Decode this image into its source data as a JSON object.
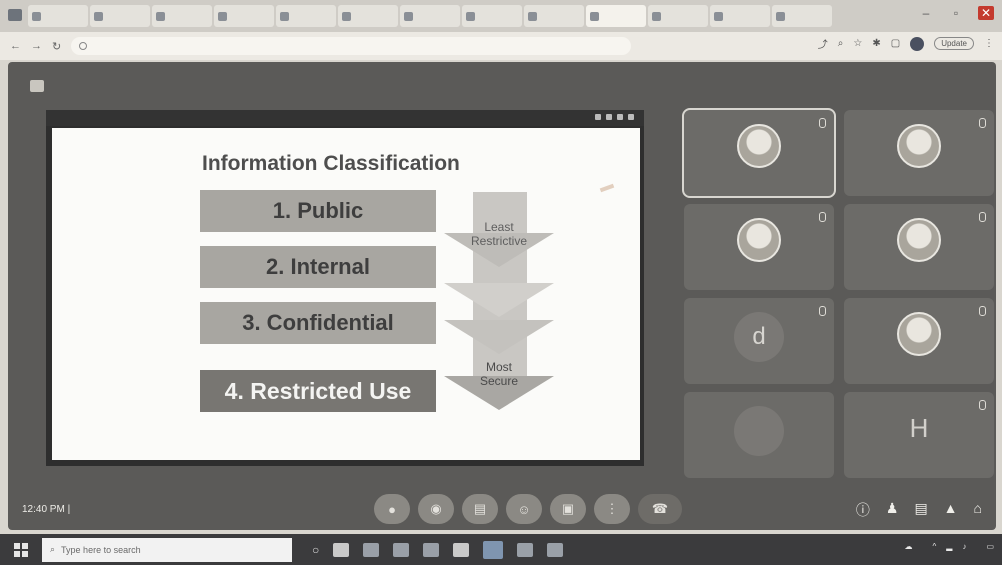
{
  "browser": {
    "tabs": [
      "",
      "",
      "",
      "",
      "",
      "",
      "",
      "",
      "",
      "",
      "",
      "",
      "",
      ""
    ],
    "active_tab": 9,
    "url": "",
    "update_label": "Update"
  },
  "meeting": {
    "title": "",
    "clock": "12:40 PM",
    "meeting_code": ""
  },
  "slide": {
    "title": "Information Classification",
    "levels": [
      "1. Public",
      "2. Internal",
      "3. Confidential",
      "4. Restricted Use"
    ],
    "arrow_top": [
      "Least",
      "Restrictive"
    ],
    "arrow_bottom": [
      "Most",
      "Secure"
    ]
  },
  "participants": [
    {
      "name": "",
      "type": "photo",
      "label": ""
    },
    {
      "name": "",
      "type": "photo",
      "label": ""
    },
    {
      "name": "",
      "type": "photo",
      "label": ""
    },
    {
      "name": "",
      "type": "photo",
      "label": ""
    },
    {
      "name": "",
      "type": "letter",
      "label": "d"
    },
    {
      "name": "",
      "type": "photo",
      "label": ""
    },
    {
      "name": "",
      "type": "letter",
      "label": ""
    },
    {
      "name": "",
      "type": "plain",
      "label": "H"
    }
  ],
  "controls": {
    "icons": [
      "mic-icon",
      "camera-icon",
      "captions-icon",
      "emoji-icon",
      "present-icon",
      "more-options-icon",
      "end-call-icon"
    ],
    "right_icons": [
      "info-icon",
      "people-icon",
      "chat-icon",
      "activities-icon",
      "host-controls-icon"
    ]
  },
  "taskbar": {
    "search_placeholder": "Type here to search",
    "weather": "",
    "time": "",
    "date": ""
  }
}
